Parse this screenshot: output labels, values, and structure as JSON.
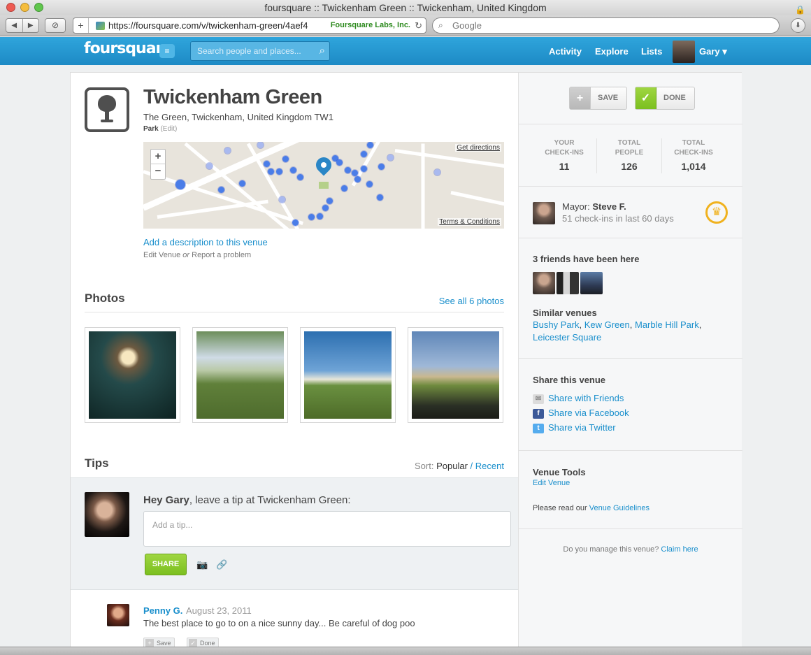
{
  "browser": {
    "window_title": "foursquare :: Twickenham Green :: Twickenham, United Kingdom",
    "url": "https://foursquare.com/v/twickenham-green/4aef4",
    "ev_cert": "Foursquare Labs, Inc.",
    "search_placeholder": "Google"
  },
  "header": {
    "logo": "foursquare",
    "search_placeholder": "Search people and places...",
    "nav": [
      "Activity",
      "Explore",
      "Lists"
    ],
    "user": "Gary"
  },
  "venue": {
    "name": "Twickenham Green",
    "address": "The Green, Twickenham, United Kingdom TW1",
    "category": "Park",
    "category_edit": "(Edit)",
    "map_directions": "Get directions",
    "map_terms": "Terms & Conditions",
    "add_description": "Add a description to this venue",
    "edit_venue": "Edit Venue",
    "or": "or",
    "report_problem": "Report a problem"
  },
  "photos": {
    "title": "Photos",
    "see_all": "See all 6 photos"
  },
  "tips": {
    "title": "Tips",
    "sort_label": "Sort:",
    "sort_popular": "Popular",
    "sort_separator": "/",
    "sort_recent": "Recent",
    "prompt_name": "Hey Gary",
    "prompt_rest": ", leave a tip at Twickenham Green:",
    "input_placeholder": "Add a tip...",
    "share_label": "SHARE",
    "items": [
      {
        "author": "Penny G.",
        "date": "August 23, 2011",
        "text": "The best place to go to on a nice sunny day... Be careful of dog poo",
        "save": "Save",
        "done": "Done"
      }
    ]
  },
  "sidebar": {
    "save_label": "SAVE",
    "done_label": "DONE",
    "stats": [
      {
        "label1": "YOUR",
        "label2": "CHECK-INS",
        "value": "11"
      },
      {
        "label1": "TOTAL",
        "label2": "PEOPLE",
        "value": "126"
      },
      {
        "label1": "TOTAL",
        "label2": "CHECK-INS",
        "value": "1,014"
      }
    ],
    "mayor_label": "Mayor:",
    "mayor_name": "Steve F.",
    "mayor_sub": "51 check-ins in last 60 days",
    "friends_title": "3 friends have been here",
    "similar_title": "Similar venues",
    "similar": [
      "Bushy Park",
      "Kew Green",
      "Marble Hill Park",
      "Leicester Square"
    ],
    "share_title": "Share this venue",
    "share_links": [
      "Share with Friends",
      "Share via Facebook",
      "Share via Twitter"
    ],
    "tools_title": "Venue Tools",
    "tools_edit": "Edit Venue",
    "guide_prefix": "Please read our",
    "guide_link": "Venue Guidelines",
    "manage_prefix": "Do you manage this venue?",
    "manage_link": "Claim here"
  }
}
